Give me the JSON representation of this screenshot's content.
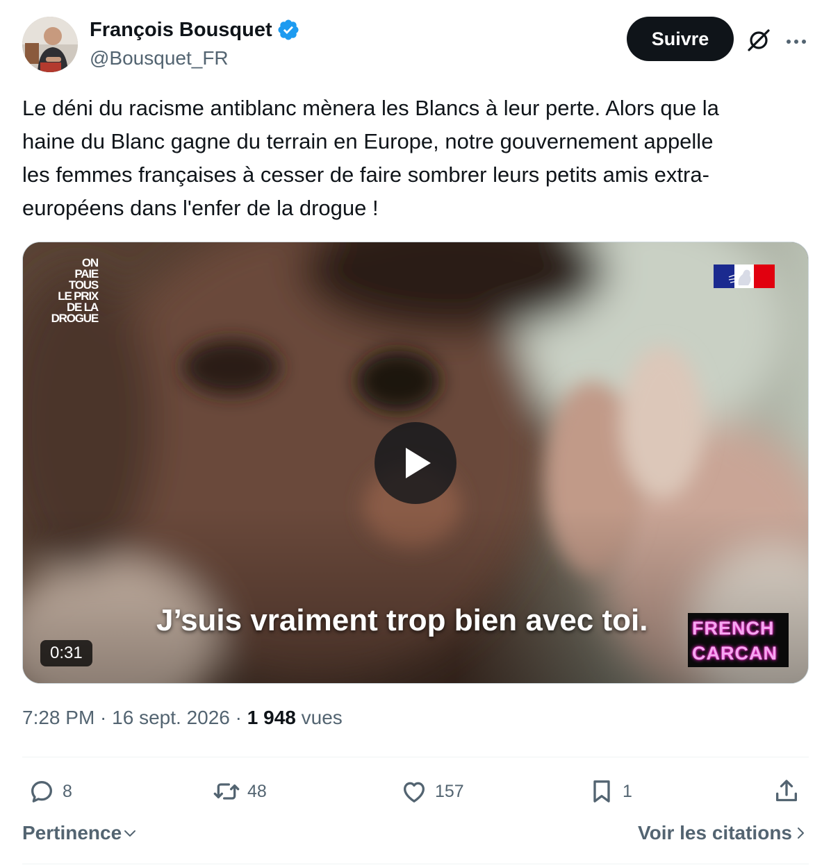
{
  "author": {
    "name": "François Bousquet",
    "handle": "@Bousquet_FR"
  },
  "header": {
    "follow_label": "Suivre"
  },
  "tweet": {
    "text": "Le déni du racisme antiblanc mènera les Blancs à leur perte. Alors que la\nhaine du Blanc gagne du terrain en Europe, notre gouvernement appelle\nles femmes françaises à cesser de faire sombrer leurs petits amis extra-\neuropéens dans l'enfer de la drogue !"
  },
  "video": {
    "logo_lines": [
      "ON",
      "PAIE",
      "TOUS",
      "LE PRIX",
      "DE LA",
      "DROGUE"
    ],
    "subtitle": "J’suis vraiment trop bien avec toi.",
    "watermark_line1": "FRENCH",
    "watermark_line2": "CARCAN",
    "duration": "0:31"
  },
  "meta": {
    "time": "7:28 PM",
    "date": "16 sept. 2026",
    "views_count": "1 948",
    "views_label": "vues"
  },
  "actions": {
    "replies": "8",
    "reposts": "48",
    "likes": "157",
    "bookmarks": "1"
  },
  "footer": {
    "sort_label": "Pertinence",
    "quotes_label": "Voir les citations"
  },
  "colors": {
    "text_primary": "#0f1419",
    "text_secondary": "#536471",
    "verified_blue": "#1d9bf0",
    "follow_bg": "#0f1419",
    "divider": "#eff3f4",
    "watermark_pink": "#f5a6f0"
  }
}
